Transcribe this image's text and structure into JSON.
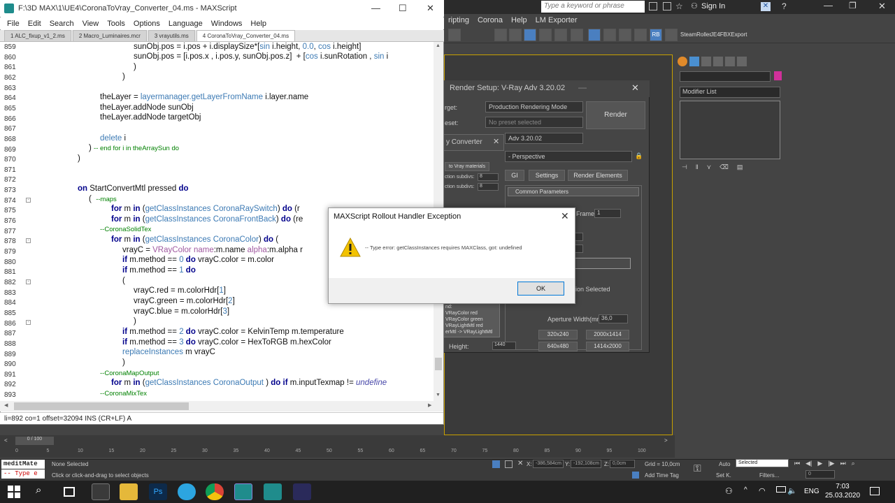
{
  "max": {
    "menu": [
      "ripting",
      "Corona",
      "Help",
      "LM Exporter"
    ],
    "search_placeholder": "Type a keyword or phrase",
    "sign_in": "Sign In",
    "toolbar_labels": [
      "SteamRoller",
      "JE4FBXExport"
    ],
    "modifier_list": "Modifier List"
  },
  "render_setup": {
    "title": "Render Setup: V-Ray Adv 3.20.02",
    "target_label": "rget:",
    "target_value": "Production Rendering Mode",
    "preset_label": "eset:",
    "preset_value": "No preset selected",
    "render_button": "Render",
    "renderer_value": "Adv 3.20.02",
    "view_value": "- Perspective",
    "tabs": [
      "GI",
      "Settings",
      "Render Elements"
    ],
    "common_params": "Common Parameters",
    "frame_label": "Frame:",
    "frame_value": "1",
    "region_selected": "gion Selected",
    "aperture_label": "Aperture Width(mm):",
    "aperture_value": "36,0",
    "height_label": "Height:",
    "height_value": "1440",
    "sizes": [
      "320x240",
      "2000x1414",
      "640x480",
      "1414x2000"
    ]
  },
  "converter": {
    "title": "y Converter",
    "button": "to Vray materials",
    "subdiv1_label": "ction subdivs:",
    "subdiv1_value": "8",
    "subdiv2_label": "ction subdivs:",
    "subdiv2_value": "8",
    "legend": [
      "nd:",
      "VRayColor red",
      "VRayColor green",
      "VRayLightMtl red",
      "erMtl -> VRayLightMtl"
    ]
  },
  "editor": {
    "title": "F:\\3D MAX\\1\\UE4\\CoronaToVray_Converter_04.ms - MAXScript",
    "menu": [
      "File",
      "Edit",
      "Search",
      "View",
      "Tools",
      "Options",
      "Language",
      "Windows",
      "Help"
    ],
    "tabs": [
      "1 ALC_fixup_v1_2.ms",
      "2 Macro_Luminaires.mcr",
      "3 vrayutils.ms",
      "4 CoronaToVray_Converter_04.ms"
    ],
    "line_numbers": [
      "859",
      "860",
      "861",
      "862",
      "863",
      "864",
      "865",
      "866",
      "867",
      "868",
      "869",
      "870",
      "871",
      "872",
      "873",
      "874",
      "875",
      "876",
      "877",
      "878",
      "879",
      "880",
      "881",
      "882",
      "883",
      "884",
      "885",
      "886",
      "887",
      "888",
      "889",
      "890",
      "891",
      "892",
      "893"
    ],
    "status": "li=892 co=1 offset=32094 INS (CR+LF) A"
  },
  "dialog": {
    "title": "MAXScript Rollout Handler Exception",
    "message": "-- Type error: getClassInstances requires MAXClass, got: undefined",
    "ok": "OK"
  },
  "timeline": {
    "slider": "0 / 100",
    "ticks": [
      "0",
      "5",
      "10",
      "15",
      "20",
      "25",
      "30",
      "35",
      "40",
      "45",
      "50",
      "55",
      "60",
      "65",
      "70",
      "75",
      "80",
      "85",
      "90",
      "95",
      "100"
    ]
  },
  "statusbar": {
    "listener1": "meditMate",
    "listener2": "-- Type e",
    "none_selected": "None Selected",
    "prompt": "Click or click-and-drag to select objects",
    "x_value": "-386,584cm",
    "y_value": "-192,108cm",
    "z_value": "0,0cm",
    "grid": "Grid = 10,0cm",
    "add_time_tag": "Add Time Tag",
    "auto": "Auto",
    "selected": "Selected",
    "setk": "Set K.",
    "filters": "Filters...",
    "frame": "0"
  },
  "taskbar": {
    "lang": "ENG",
    "time": "7:03",
    "date": "25.03.2020"
  }
}
